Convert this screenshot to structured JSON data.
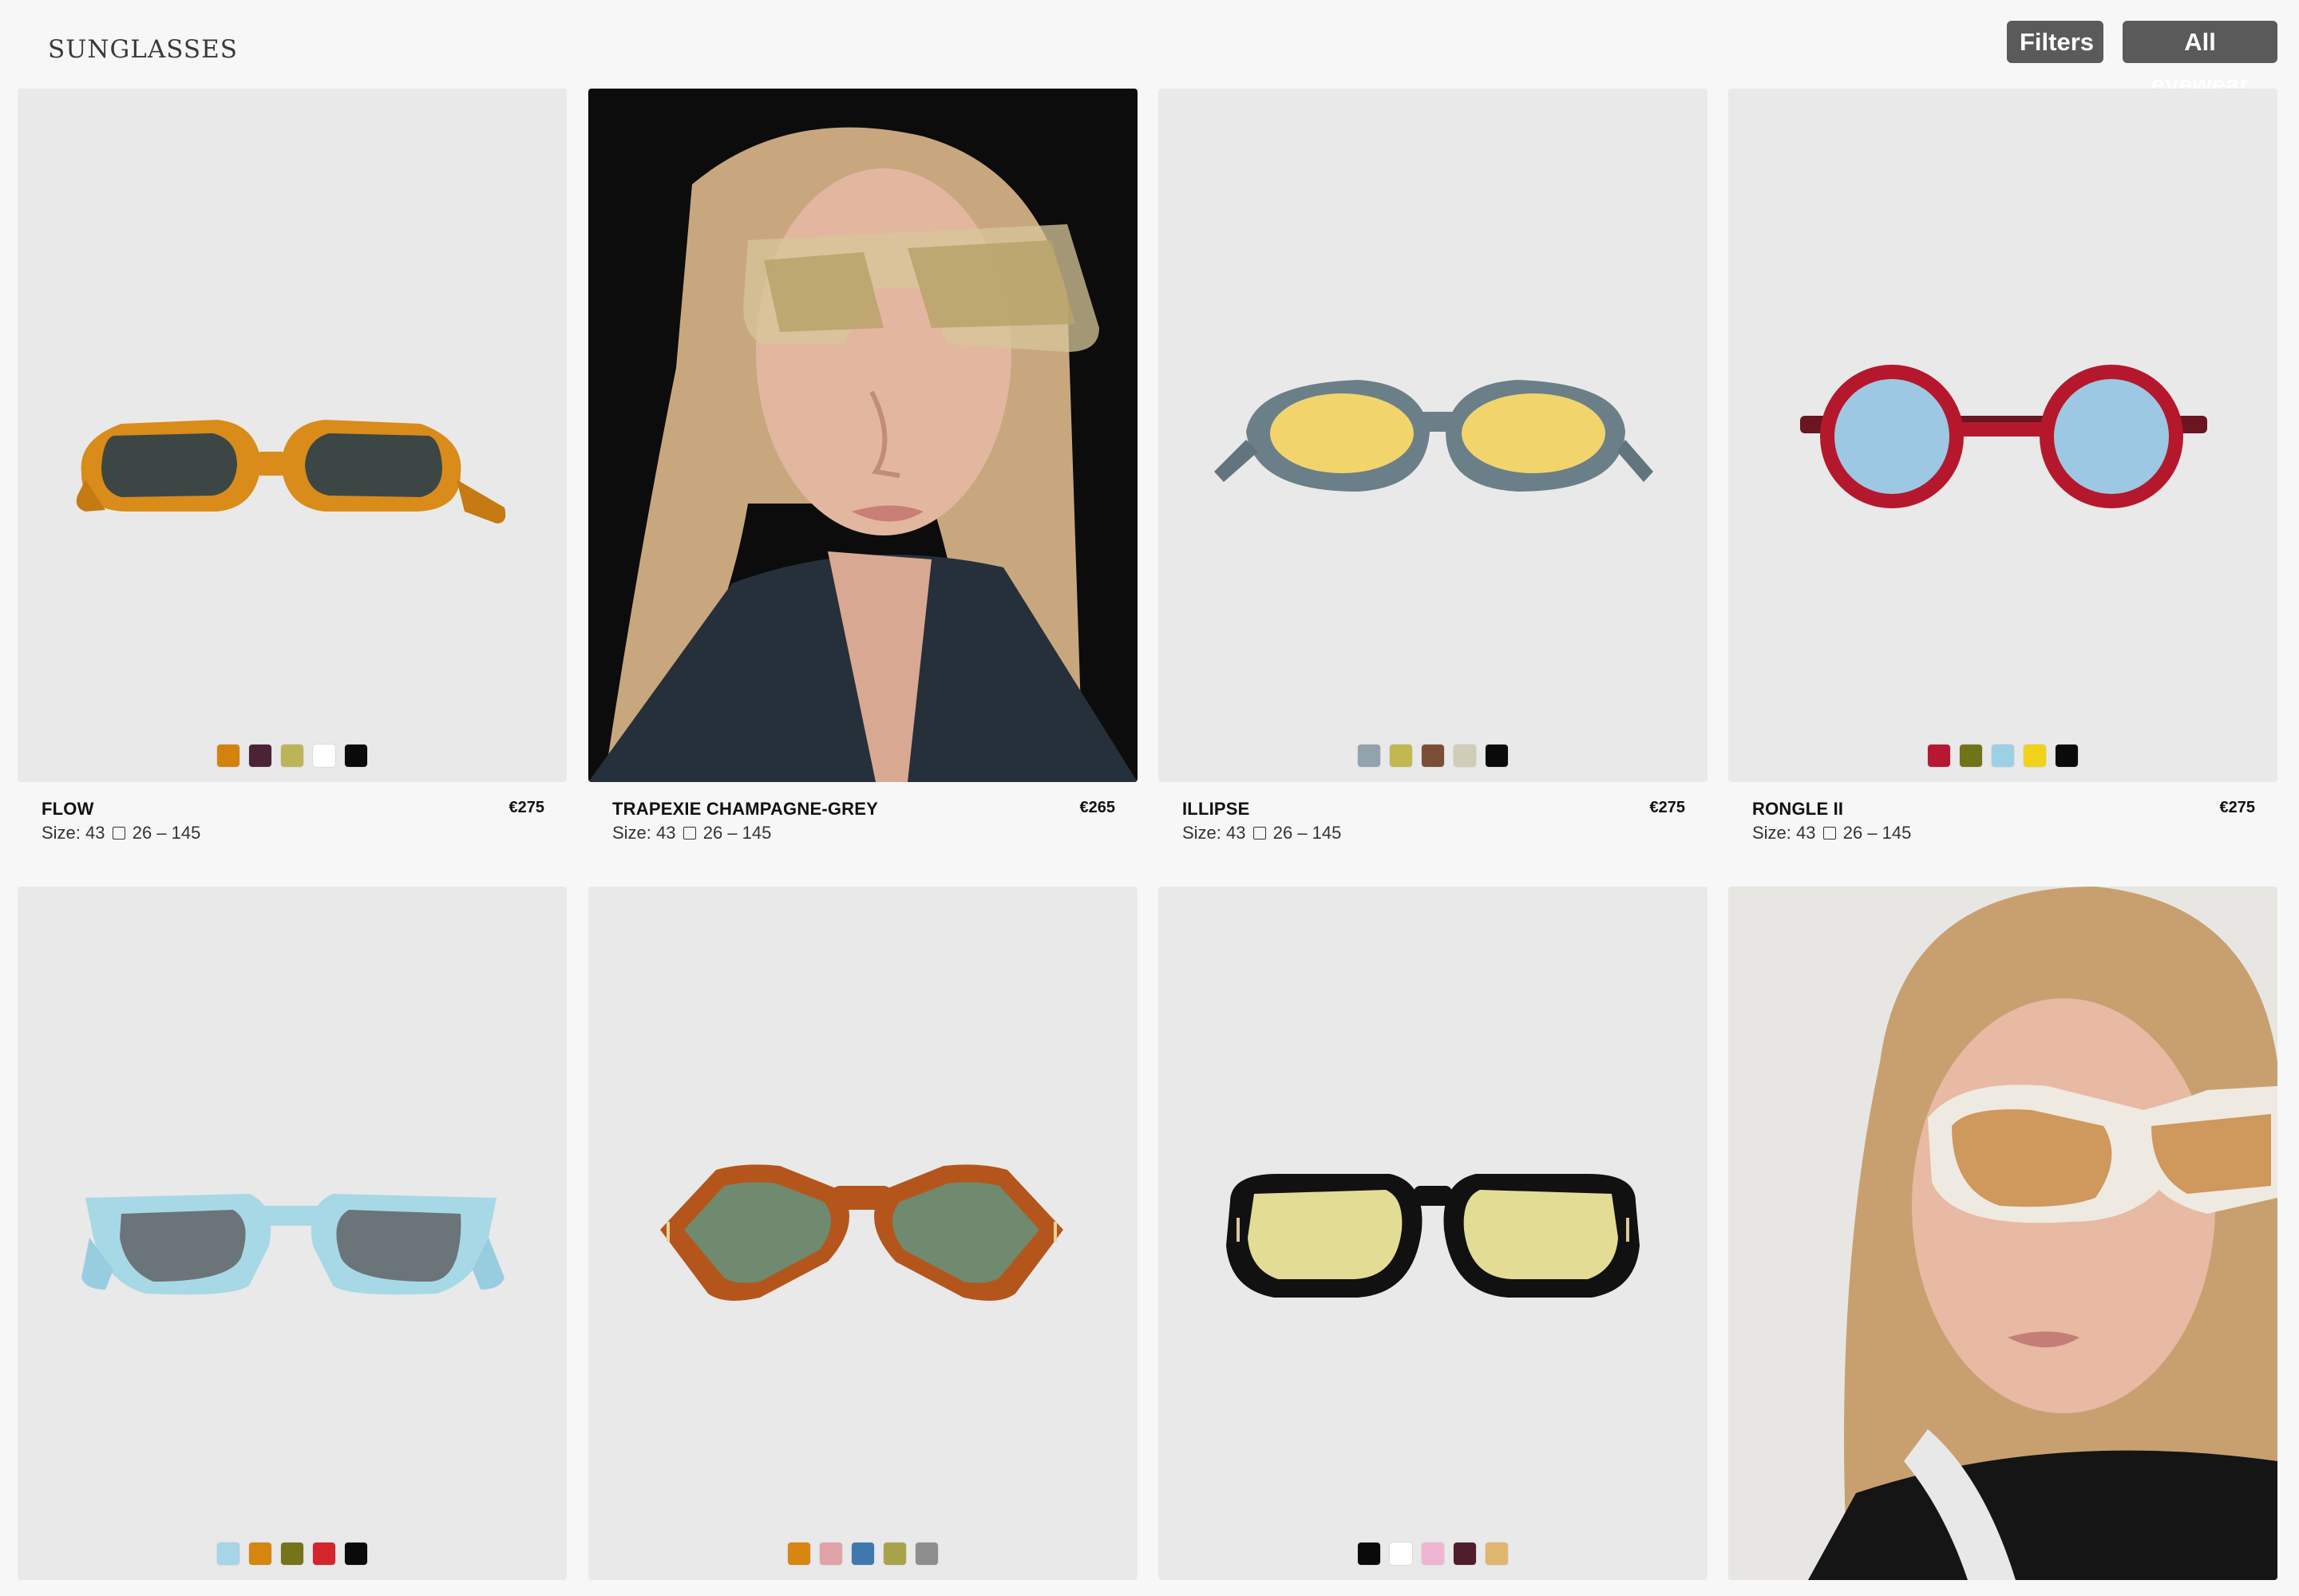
{
  "header": {
    "title": "SUNGLASSES",
    "filters_label": "Filters",
    "all_eyewear_label": "All eyewear"
  },
  "products": [
    {
      "name": "FLOW",
      "price": "€275",
      "size_prefix": "Size: 43",
      "size_rest": "26 – 145",
      "swatches": [
        "#d4820e",
        "#4a2435",
        "#bdb45a",
        "#ffffff",
        "#0a0a0a"
      ]
    },
    {
      "name": "TRAPEXIE CHAMPAGNE-GREY",
      "price": "€265",
      "size_prefix": "Size: 43",
      "size_rest": "26 – 145",
      "swatches": []
    },
    {
      "name": "ILLIPSE",
      "price": "€275",
      "size_prefix": "Size: 43",
      "size_rest": "26 – 145",
      "swatches": [
        "#93a3ae",
        "#c2b850",
        "#7b4e35",
        "#cfcdb7",
        "#0a0a0a"
      ]
    },
    {
      "name": "RONGLE II",
      "price": "€275",
      "size_prefix": "Size: 43",
      "size_rest": "26 – 145",
      "swatches": [
        "#b51830",
        "#6f7418",
        "#9dd0e4",
        "#f1d21b",
        "#0a0a0a"
      ]
    },
    {
      "name": "",
      "price": "",
      "size_prefix": "",
      "size_rest": "",
      "swatches": [
        "#a5d5e6",
        "#d4860e",
        "#747418",
        "#d4242c",
        "#0a0a0a"
      ]
    },
    {
      "name": "",
      "price": "",
      "size_prefix": "",
      "size_rest": "",
      "swatches": [
        "#d88512",
        "#e0a3a7",
        "#3f78ac",
        "#a8a34a",
        "#8e8e8e"
      ]
    },
    {
      "name": "",
      "price": "",
      "size_prefix": "",
      "size_rest": "",
      "swatches": [
        "#0a0a0a",
        "#ffffff",
        "#f0b5d3",
        "#4f1d2b",
        "#e0b56f"
      ]
    },
    {
      "name": "",
      "price": "",
      "size_prefix": "",
      "size_rest": "",
      "swatches": []
    }
  ],
  "icons": {
    "size_separator": "square-outline-icon"
  }
}
